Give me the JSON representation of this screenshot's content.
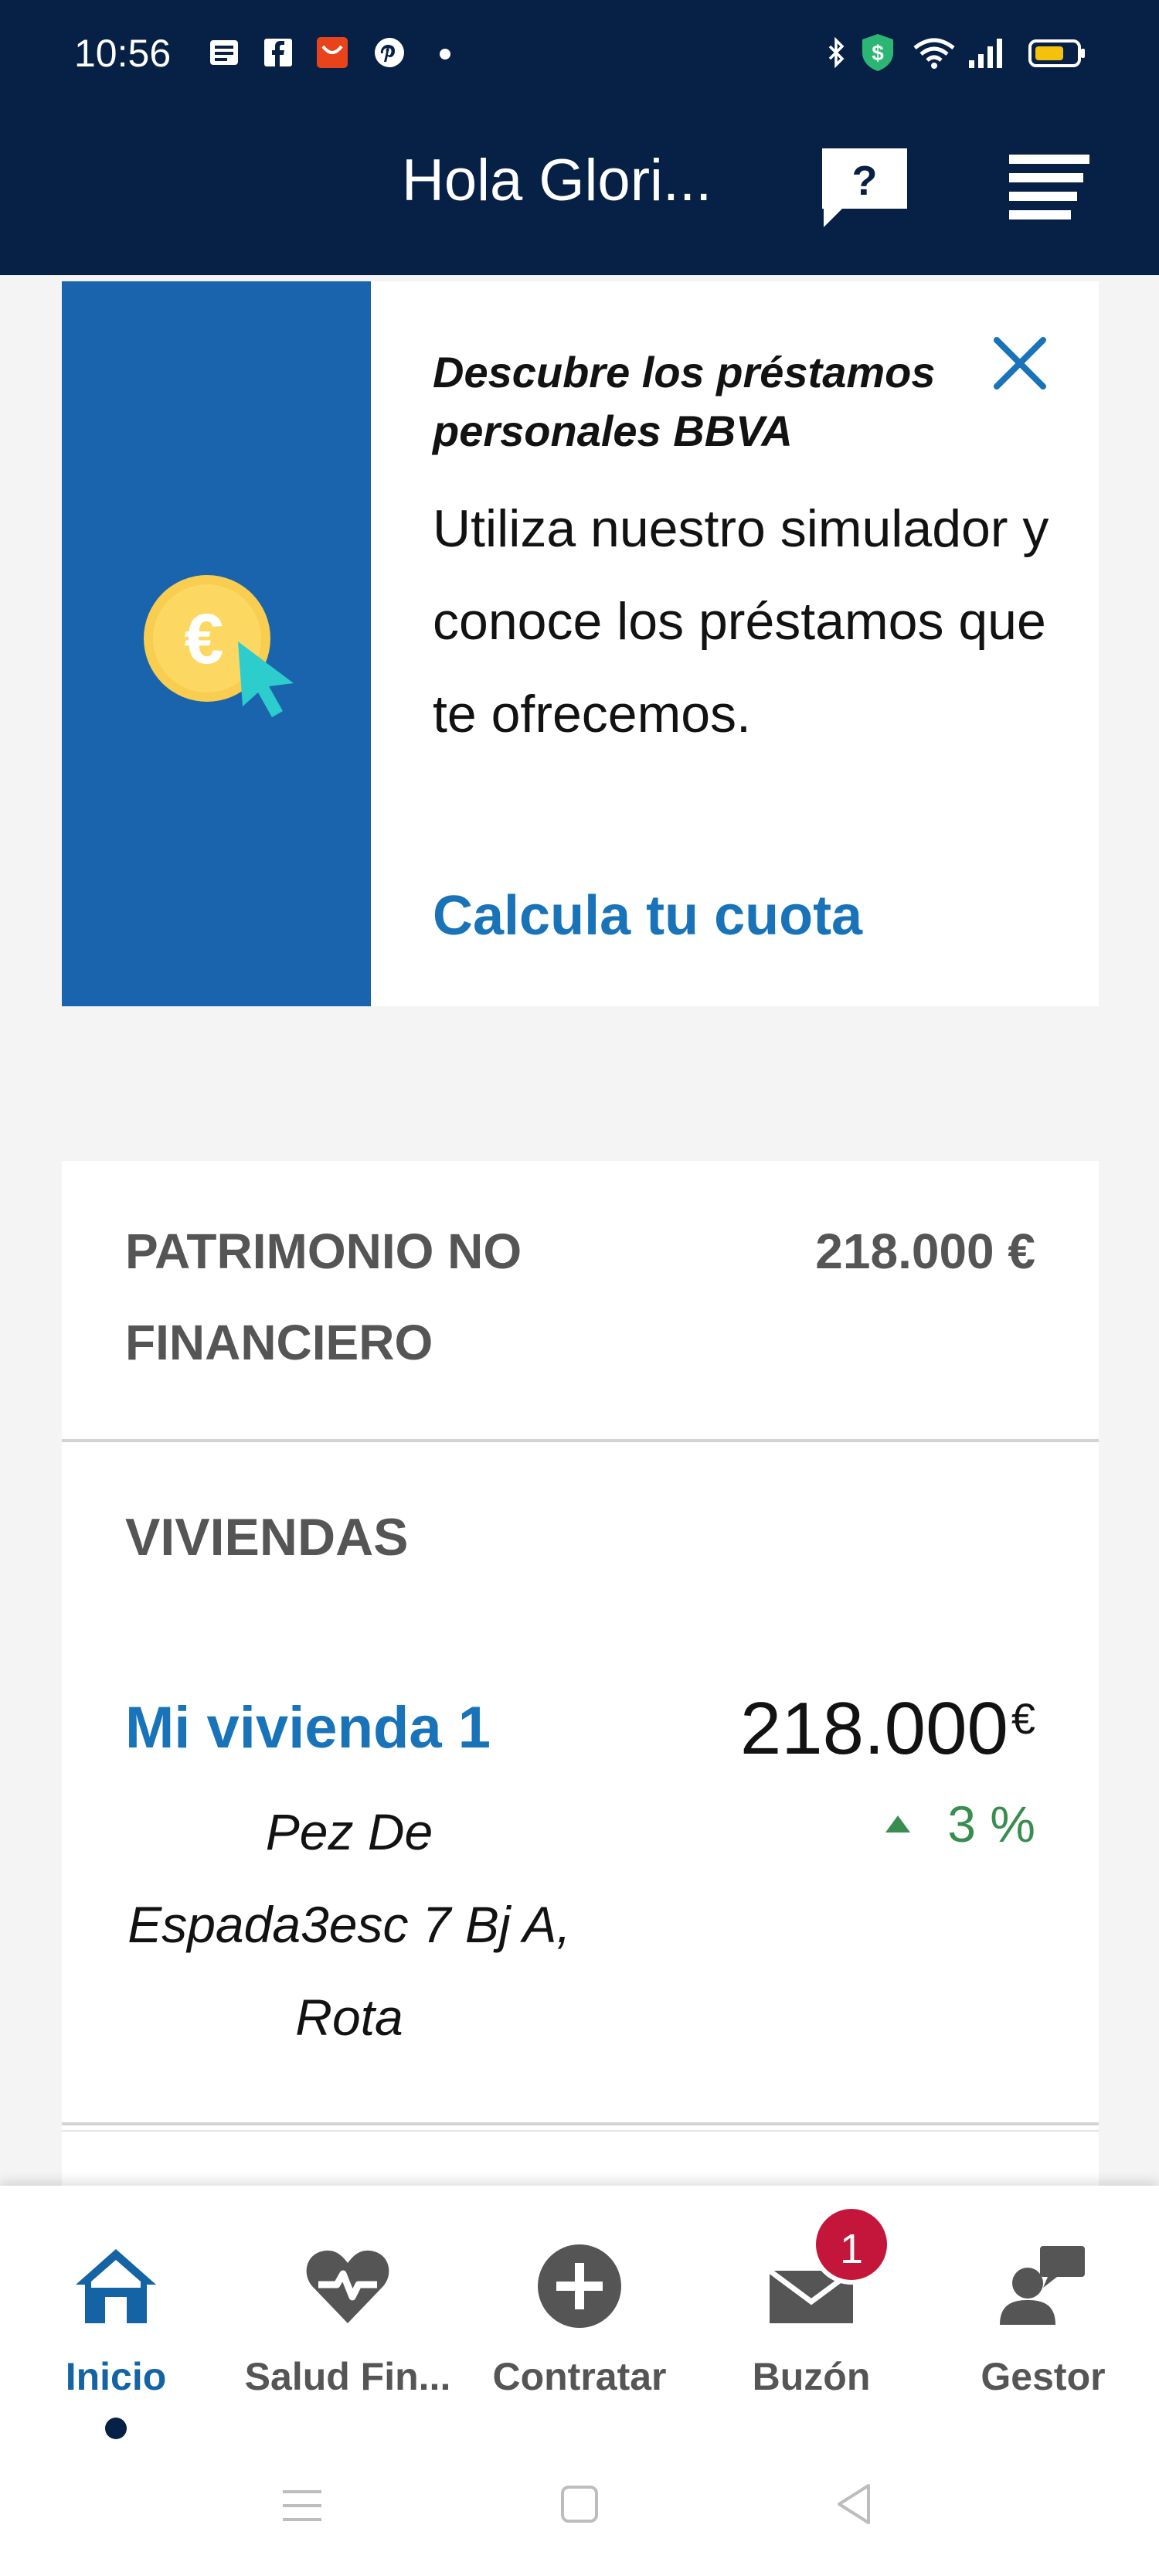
{
  "status_bar": {
    "time": "10:56",
    "icons": [
      "notification-news-icon",
      "facebook-icon",
      "aliexpress-icon",
      "pinterest-icon",
      "dot-icon",
      "bluetooth-icon",
      "shield-dollar-icon",
      "wifi-icon",
      "signal-icon",
      "battery-icon"
    ],
    "battery_color": "#f4c20d"
  },
  "header": {
    "greeting": "Hola Glori...",
    "help_label": "?",
    "background": "#072146"
  },
  "promo": {
    "title": "Descubre los préstamos personales BBVA",
    "body": "Utiliza nuestro simulador y conoce los préstamos que te ofrecemos.",
    "link": "Calcula tu cuota",
    "icon": "euro-coin-cursor-icon",
    "accent": "#1a64ad"
  },
  "wealth": {
    "heading": "PATRIMONIO NO FINANCIERO",
    "total": "218.000 €",
    "section": "VIVIENDAS",
    "property": {
      "name": "Mi vivienda 1",
      "address": "Pez De Espada3esc 7 Bj A, Rota",
      "value": "218.000",
      "currency": "€",
      "change": "3 %",
      "change_color": "#388d4f"
    }
  },
  "bottom_nav": {
    "items": [
      {
        "label": "Inicio",
        "icon": "home-icon",
        "active": true
      },
      {
        "label": "Salud Fin...",
        "icon": "heart-health-icon",
        "active": false
      },
      {
        "label": "Contratar",
        "icon": "plus-circle-icon",
        "active": false
      },
      {
        "label": "Buzón",
        "icon": "mailbox-icon",
        "active": false,
        "badge": "1"
      },
      {
        "label": "Gestor",
        "icon": "advisor-chat-icon",
        "active": false
      }
    ]
  },
  "system_nav": [
    "menu-lines-icon",
    "home-square-icon",
    "back-triangle-icon"
  ]
}
